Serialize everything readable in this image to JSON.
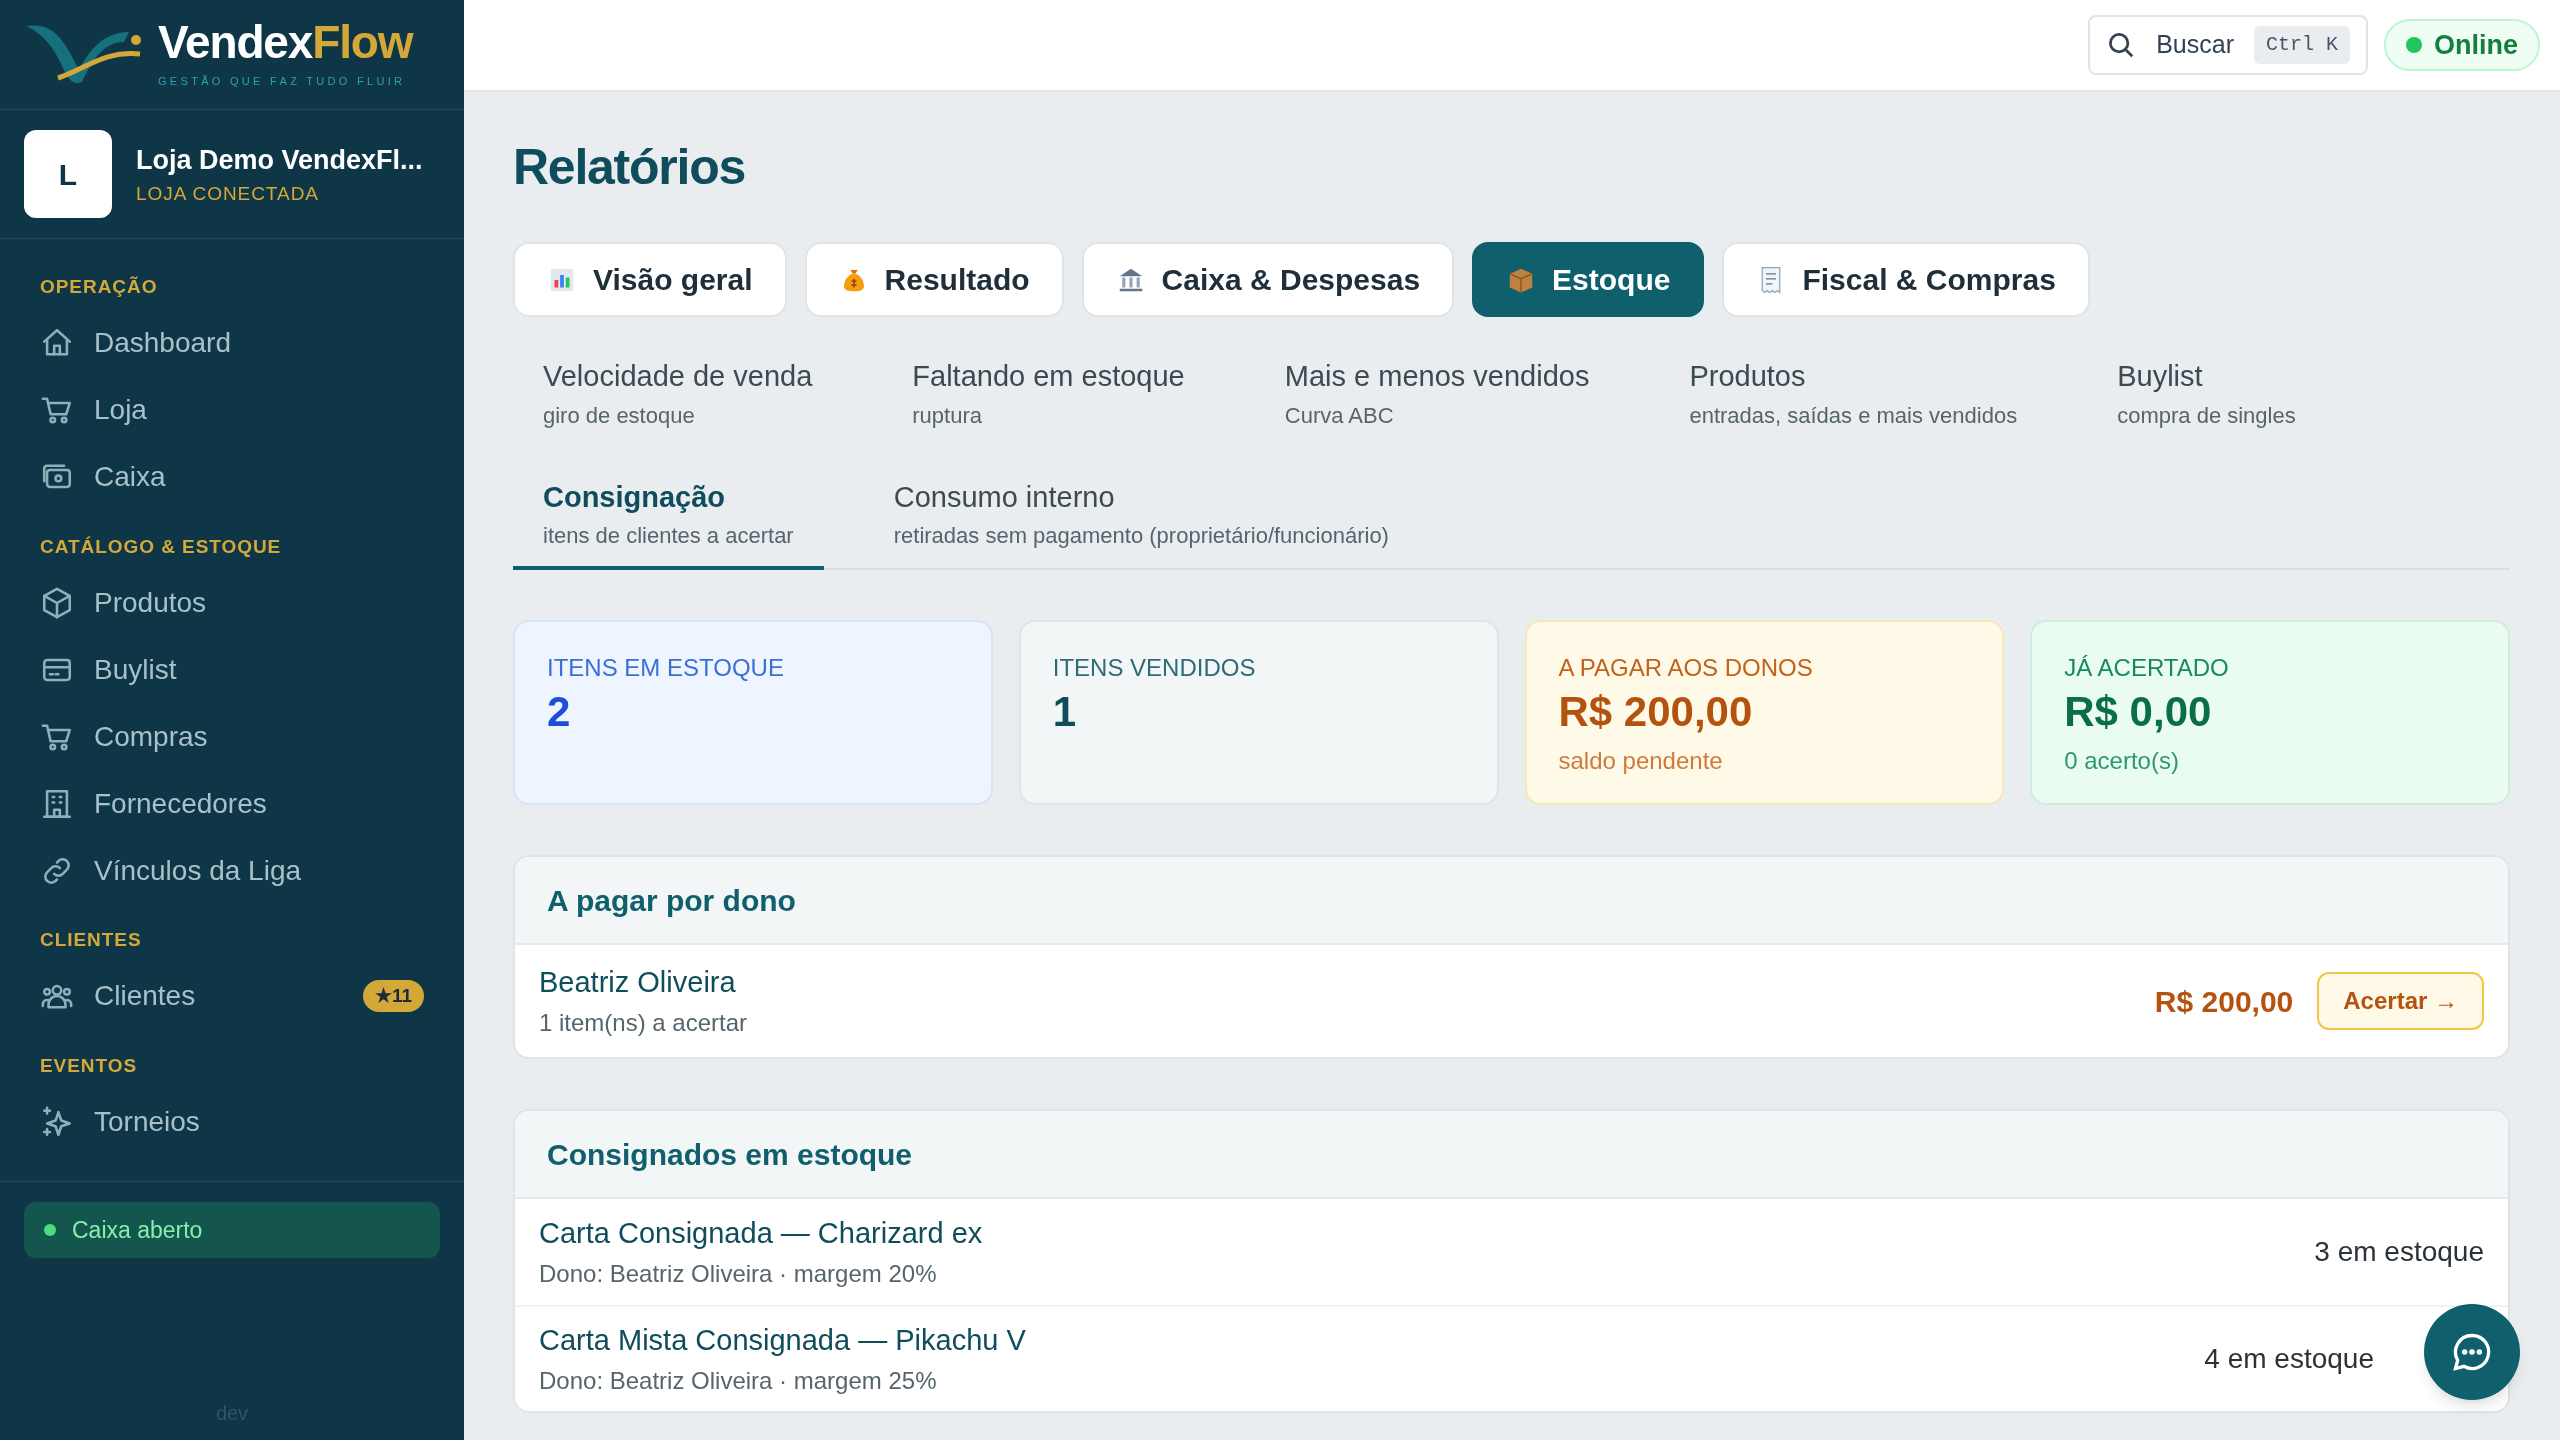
{
  "brand": {
    "name_start": "Vendex",
    "name_end": "Flow",
    "tagline": "GESTÃO QUE FAZ TUDO FLUIR"
  },
  "store": {
    "initial": "L",
    "name": "Loja Demo VendexFl...",
    "status": "LOJA CONECTADA"
  },
  "sidebar": {
    "sections": [
      {
        "title": "OPERAÇÃO",
        "items": [
          {
            "label": "Dashboard"
          },
          {
            "label": "Loja"
          },
          {
            "label": "Caixa"
          }
        ]
      },
      {
        "title": "CATÁLOGO & ESTOQUE",
        "items": [
          {
            "label": "Produtos"
          },
          {
            "label": "Buylist"
          },
          {
            "label": "Compras"
          },
          {
            "label": "Fornecedores"
          },
          {
            "label": "Vínculos da Liga"
          }
        ]
      },
      {
        "title": "CLIENTES",
        "items": [
          {
            "label": "Clientes",
            "badge": "★11"
          }
        ]
      },
      {
        "title": "EVENTOS",
        "items": [
          {
            "label": "Torneios"
          }
        ]
      }
    ]
  },
  "cash_status": "Caixa aberto",
  "environment": "dev",
  "header": {
    "search": {
      "label": "Buscar",
      "shortcut": "Ctrl K"
    },
    "connection": "Online"
  },
  "page_title": "Relatórios",
  "tabs": [
    {
      "label": "Visão geral",
      "selected": false
    },
    {
      "label": "Resultado",
      "selected": false
    },
    {
      "label": "Caixa & Despesas",
      "selected": false
    },
    {
      "label": "Estoque",
      "selected": true
    },
    {
      "label": "Fiscal & Compras",
      "selected": false
    }
  ],
  "subtabs": [
    {
      "title": "Velocidade de venda",
      "subtitle": "giro de estoque",
      "selected": false
    },
    {
      "title": "Faltando em estoque",
      "subtitle": "ruptura",
      "selected": false
    },
    {
      "title": "Mais e menos vendidos",
      "subtitle": "Curva ABC",
      "selected": false
    },
    {
      "title": "Produtos",
      "subtitle": "entradas, saídas e mais vendidos",
      "selected": false
    },
    {
      "title": "Buylist",
      "subtitle": "compra de singles",
      "selected": false
    },
    {
      "title": "Consignação",
      "subtitle": "itens de clientes a acertar",
      "selected": true
    },
    {
      "title": "Consumo interno",
      "subtitle": "retiradas sem pagamento (proprietário/funcionário)",
      "selected": false
    }
  ],
  "stats": [
    {
      "kind": "info",
      "label": "ITENS EM ESTOQUE",
      "value": "2"
    },
    {
      "kind": "neutral",
      "label": "ITENS VENDIDOS",
      "value": "1"
    },
    {
      "kind": "warning",
      "label": "A PAGAR AOS DONOS",
      "value": "R$ 200,00",
      "note": "saldo pendente"
    },
    {
      "kind": "success",
      "label": "JÁ ACERTADO",
      "value": "R$ 0,00",
      "note": "0 acerto(s)"
    }
  ],
  "owners_panel": {
    "title": "A pagar por dono",
    "rows": [
      {
        "name": "Beatriz Oliveira",
        "detail": "1 item(ns) a acertar",
        "amount": "R$ 200,00",
        "action": "Acertar →"
      }
    ]
  },
  "stock_panel": {
    "title": "Consignados em estoque",
    "rows": [
      {
        "name": "Carta Consignada — Charizard ex",
        "detail": "Dono: Beatriz Oliveira · margem 20%",
        "quantity": "3 em estoque"
      },
      {
        "name": "Carta Mista Consignada — Pikachu V",
        "detail": "Dono: Beatriz Oliveira · margem 25%",
        "quantity": "4 em estoque"
      }
    ]
  }
}
